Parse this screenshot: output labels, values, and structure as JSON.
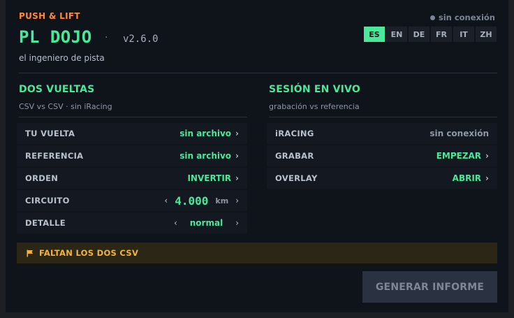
{
  "header": {
    "brand": "PUSH & LIFT",
    "title": "PL DOJO",
    "separator": "·",
    "version": "v2.6.0",
    "subtitle": "el ingeniero de pista",
    "connection_status": "sin conexión",
    "languages": [
      "ES",
      "EN",
      "DE",
      "FR",
      "IT",
      "ZH"
    ],
    "active_language": "ES"
  },
  "laps": {
    "title": "DOS VUELTAS",
    "subtitle": "CSV vs CSV · sin iRacing",
    "rows": {
      "your_lap": {
        "label": "TU VUELTA",
        "value": "sin archivo"
      },
      "reference": {
        "label": "REFERENCIA",
        "value": "sin archivo"
      },
      "order": {
        "label": "ORDEN",
        "value": "INVERTIR"
      },
      "circuit": {
        "label": "CIRCUITO",
        "value": "4.000",
        "unit": "km"
      },
      "detail": {
        "label": "DETALLE",
        "value": "normal"
      }
    }
  },
  "live": {
    "title": "SESIÓN EN VIVO",
    "subtitle": "grabación vs referencia",
    "rows": {
      "iracing": {
        "label": "iRACING",
        "value": "sin conexión"
      },
      "record": {
        "label": "GRABAR",
        "value": "EMPEZAR"
      },
      "overlay": {
        "label": "OVERLAY",
        "value": "ABRIR"
      }
    }
  },
  "warning": {
    "text": "FALTAN LOS DOS CSV"
  },
  "actions": {
    "generate": "GENERAR INFORME"
  },
  "colors": {
    "accent": "#49e89a",
    "brand": "#ff8a3d",
    "warning": "#f2b33d",
    "background": "#0f131a"
  },
  "icons": {
    "warning": "flag-icon",
    "chevron": "chevron-right-icon",
    "decrement": "chevron-left-icon"
  }
}
